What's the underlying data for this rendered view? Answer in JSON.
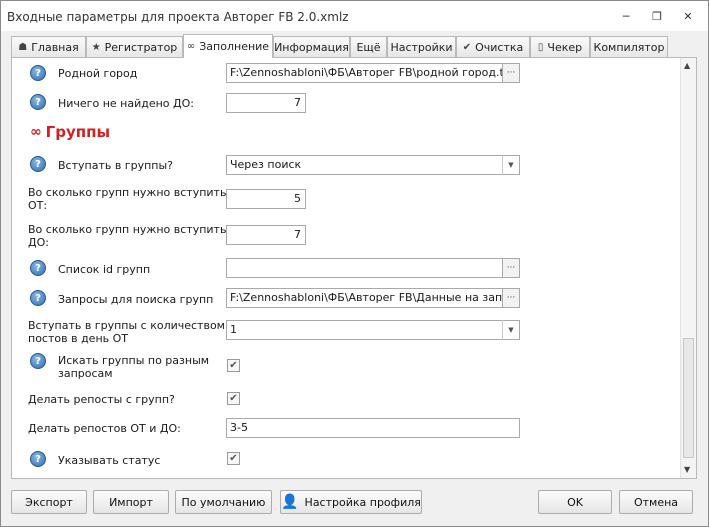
{
  "window": {
    "title": "Входные параметры для проекта Авторег FB 2.0.xmlz",
    "minimize_glyph": "─",
    "restore_glyph": "❐",
    "close_glyph": "✕"
  },
  "tabs": [
    {
      "label": "Главная",
      "icon": "home-icon",
      "glyph": "☗"
    },
    {
      "label": "Регистратор",
      "icon": "star-icon",
      "glyph": "★"
    },
    {
      "label": "Заполнение",
      "icon": "infinity-icon",
      "glyph": "∞",
      "active": true
    },
    {
      "label": "Информация"
    },
    {
      "label": "Ещё"
    },
    {
      "label": "Настройки"
    },
    {
      "label": "Очистка",
      "icon": "check-icon",
      "glyph": "✔"
    },
    {
      "label": "Чекер",
      "icon": "document-icon",
      "glyph": "▯"
    },
    {
      "label": "Компилятор"
    }
  ],
  "form": {
    "home_city": {
      "label": "Родной город",
      "value": "F:\\Zennoshabloni\\ФБ\\Авторег FB\\родной город.txt"
    },
    "nothing_found_to": {
      "label": "Ничего не найдено ДО:",
      "value": "7"
    },
    "groups_section": {
      "title": "Группы",
      "glyph": "∞"
    },
    "join_groups": {
      "label": "Вступать в группы?",
      "value": "Через поиск"
    },
    "groups_from": {
      "label_line1": "Во сколько групп нужно вступить",
      "label_line2": "ОТ:",
      "value": "5"
    },
    "groups_to": {
      "label_line1": "Во сколько групп нужно вступить",
      "label_line2": "ДО:",
      "value": "7"
    },
    "group_ids": {
      "label": "Список id групп",
      "value": ""
    },
    "group_queries": {
      "label": "Запросы для поиска групп",
      "value": "F:\\Zennoshabloni\\ФБ\\Авторег FB\\Данные на заполнен"
    },
    "posts_per_day": {
      "label_line1": "Вступать в группы с количеством",
      "label_line2": "постов в день ОТ",
      "value": "1"
    },
    "search_different": {
      "label_line1": "Искать группы по разным",
      "label_line2": "запросам",
      "checked": true
    },
    "reposts": {
      "label": "Делать репосты с групп?",
      "checked": true
    },
    "reposts_range": {
      "label": "Делать репостов ОТ и ДО:",
      "value": "3-5"
    },
    "set_status": {
      "label": "Указывать статус",
      "checked": true
    }
  },
  "glyphs": {
    "question": "?",
    "ellipsis": "···",
    "dropdown": "▼",
    "check": "✔",
    "scroll_up": "▲",
    "scroll_down": "▼",
    "grip": "≡"
  },
  "buttons": {
    "export": "Экспорт",
    "import": "Импорт",
    "defaults": "По умолчанию",
    "profile_settings": "Настройка профиля",
    "ok": "OK",
    "cancel": "Отмена"
  }
}
